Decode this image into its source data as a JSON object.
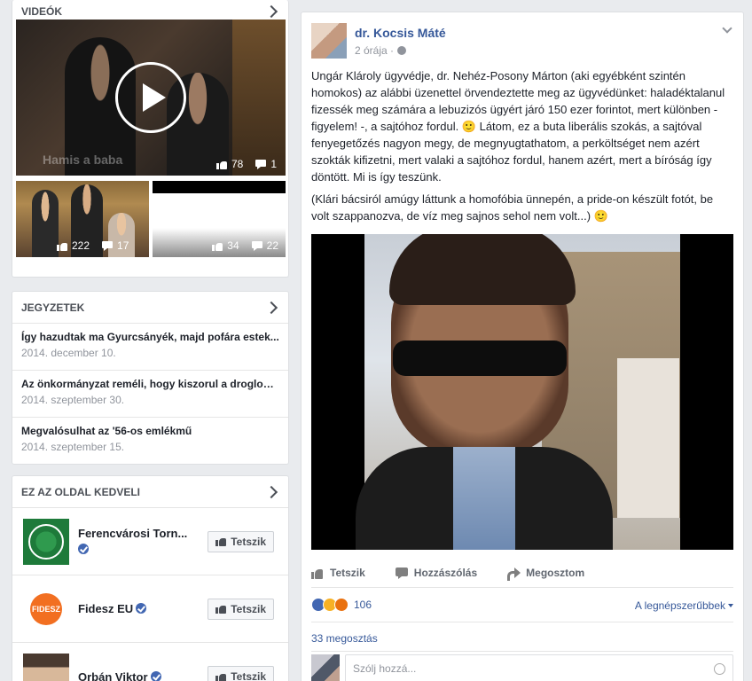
{
  "videos": {
    "heading": "VIDEÓK",
    "main": {
      "title": "Hamis a baba",
      "likes": "78",
      "comments": "1"
    },
    "small": [
      {
        "likes": "222",
        "comments": "17"
      },
      {
        "likes": "34",
        "comments": "22"
      }
    ]
  },
  "notes": {
    "heading": "JEGYZETEK",
    "items": [
      {
        "title": "Így hazudtak ma Gyurcsányék, majd pofára estek...",
        "date": "2014. december 10."
      },
      {
        "title": "Az önkormányzat reméli, hogy kiszorul a droglobbi...",
        "date": "2014. szeptember 30."
      },
      {
        "title": "Megvalósulhat az '56-os emlékmű",
        "date": "2014. szeptember 15."
      }
    ]
  },
  "likes": {
    "heading": "EZ AZ OLDAL KEDVELI",
    "pages": [
      {
        "name": "Ferencvárosi Torn...",
        "button": "Tetszik"
      },
      {
        "name": "Fidesz EU",
        "button": "Tetszik",
        "logo_text": "FIDESZ"
      },
      {
        "name": "Orbán Viktor",
        "button": "Tetszik"
      }
    ]
  },
  "post": {
    "author": "dr. Kocsis Máté",
    "time": "2 órája · ",
    "paragraphs": [
      "Ungár Klároly ügyvédje, dr. Nehéz-Posony Márton (aki egyébként szintén homokos) az alábbi üzenettel örvendeztette meg az ügyvédünket: haladéktalanul fizessék meg számára a lebuzizós ügyért járó 150 ezer forintot, mert különben - figyelem! -, a sajtóhoz fordul. 🙂 Látom, ez a buta liberális szokás, a sajtóval fenyegetőzés nagyon megy, de megnyugtathatom, a perköltséget nem azért szokták kifizetni, mert valaki a sajtóhoz fordul, hanem azért, mert a bíróság így döntött. Mi is így teszünk.",
      "(Klári bácsiról amúgy láttunk a homofóbia ünnepén, a pride-on készült fotót, be volt szappanozva, de víz meg sajnos sehol nem volt...) 🙂"
    ],
    "actions": {
      "like": "Tetszik",
      "comment": "Hozzászólás",
      "share": "Megosztom"
    },
    "reaction_count": "106",
    "sort_label": "A legnépszerűbbek",
    "shares": "33 megosztás",
    "comment_placeholder": "Szólj hozzá..."
  },
  "colors": {
    "link": "#365899",
    "meta": "#90949c",
    "fidesz_orange": "#f26f21",
    "ftc_green": "#1e7a3a"
  }
}
